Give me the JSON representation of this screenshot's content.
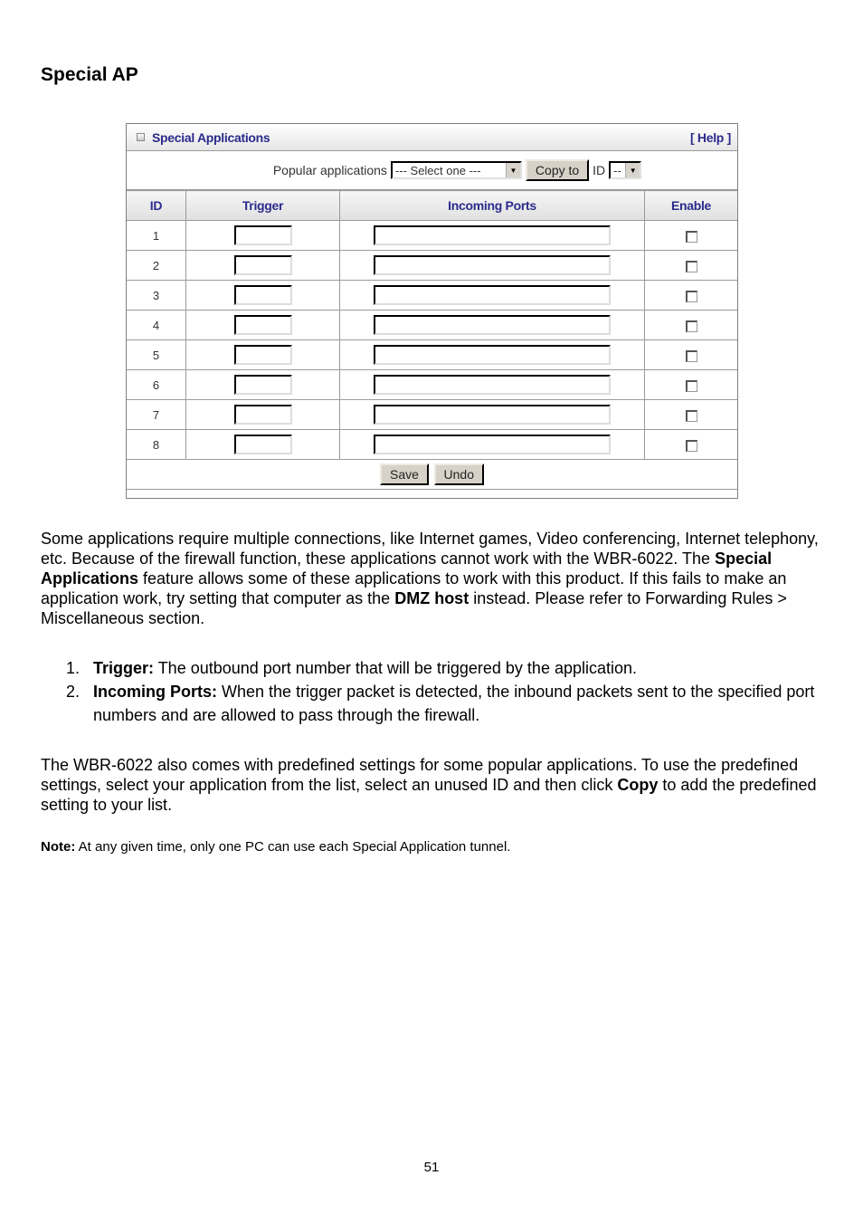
{
  "heading": "Special AP",
  "panel": {
    "title": "Special Applications",
    "help_label": "[ Help ]",
    "popular_label": "Popular applications",
    "popular_select_value": "--- Select one ---",
    "copy_button": "Copy to",
    "id_label": "ID",
    "id_select_value": "--",
    "columns": [
      "ID",
      "Trigger",
      "Incoming Ports",
      "Enable"
    ],
    "rows": [
      {
        "id": "1",
        "trigger": "",
        "ports": "",
        "enabled": false
      },
      {
        "id": "2",
        "trigger": "",
        "ports": "",
        "enabled": false
      },
      {
        "id": "3",
        "trigger": "",
        "ports": "",
        "enabled": false
      },
      {
        "id": "4",
        "trigger": "",
        "ports": "",
        "enabled": false
      },
      {
        "id": "5",
        "trigger": "",
        "ports": "",
        "enabled": false
      },
      {
        "id": "6",
        "trigger": "",
        "ports": "",
        "enabled": false
      },
      {
        "id": "7",
        "trigger": "",
        "ports": "",
        "enabled": false
      },
      {
        "id": "8",
        "trigger": "",
        "ports": "",
        "enabled": false
      }
    ],
    "save_button": "Save",
    "undo_button": "Undo",
    "accent_color": "#2b2b8c"
  },
  "paragraph1": {
    "part1": "Some applications require multiple connections, like Internet games, Video conferencing, Internet telephony, etc. Because of the firewall function, these applications cannot work with the WBR-6022. The ",
    "bold1": "Special Applications",
    "part2": " feature allows some of these applications to work with this product. If this fails to make an application work, try setting that computer as the ",
    "bold2": "DMZ host",
    "part3": " instead. Please refer to Forwarding Rules > Miscellaneous section."
  },
  "list": [
    {
      "num": "1.",
      "term": "Trigger:",
      "text": " The outbound port number that will be triggered by the application."
    },
    {
      "num": "2.",
      "term": "Incoming Ports:",
      "text": " When the trigger packet is detected, the inbound packets sent to the specified port numbers and are allowed to pass through the firewall."
    }
  ],
  "paragraph2": {
    "part1": "The WBR-6022 also comes with predefined settings for some popular applications. To use the predefined settings, select your application from the list, select an unused ID and then click ",
    "bold1": "Copy",
    "part2": " to add the predefined setting to your list."
  },
  "note": {
    "label": "Note:",
    "text": " At any given time, only one PC can use each Special Application tunnel."
  },
  "page_number": "51"
}
